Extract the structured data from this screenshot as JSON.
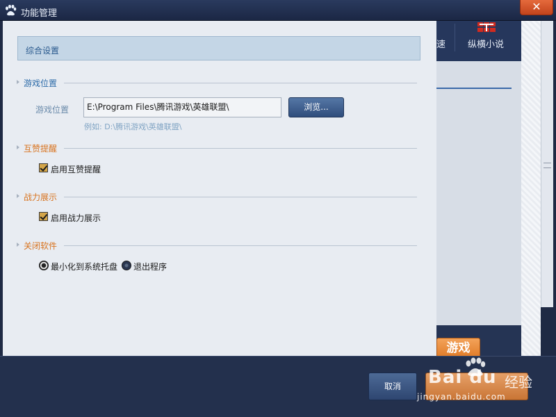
{
  "window": {
    "title": "功能管理",
    "close_glyph": "✕"
  },
  "background_app": {
    "nav_partial": "速",
    "nav_novel": "纵横小说",
    "game_button": "游戏"
  },
  "header": {
    "title": "综合设置"
  },
  "sections": {
    "game_location": {
      "heading": "游戏位置",
      "field_label": "游戏位置",
      "path_value": "E:\\Program Files\\腾讯游戏\\英雄联盟\\",
      "browse_label": "浏览...",
      "hint": "例如: D:\\腾讯游戏\\英雄联盟\\"
    },
    "mutual_like": {
      "heading": "互赞提醒",
      "checkbox_label": "启用互赞提醒",
      "checked": true
    },
    "power_display": {
      "heading": "战力展示",
      "checkbox_label": "启用战力展示",
      "checked": true
    },
    "close_software": {
      "heading": "关闭软件",
      "options": [
        {
          "label": "最小化到系统托盘",
          "selected": true
        },
        {
          "label": "退出程序",
          "selected": false
        }
      ]
    }
  },
  "footer": {
    "cancel_label": "取消"
  },
  "watermark": {
    "brand": "Bai du",
    "suffix": "经验",
    "url": "jingyan.baidu.com"
  },
  "colors": {
    "accent_blue": "#2b6aa8",
    "accent_orange": "#d8731f",
    "titlebar": "#1b2744"
  }
}
